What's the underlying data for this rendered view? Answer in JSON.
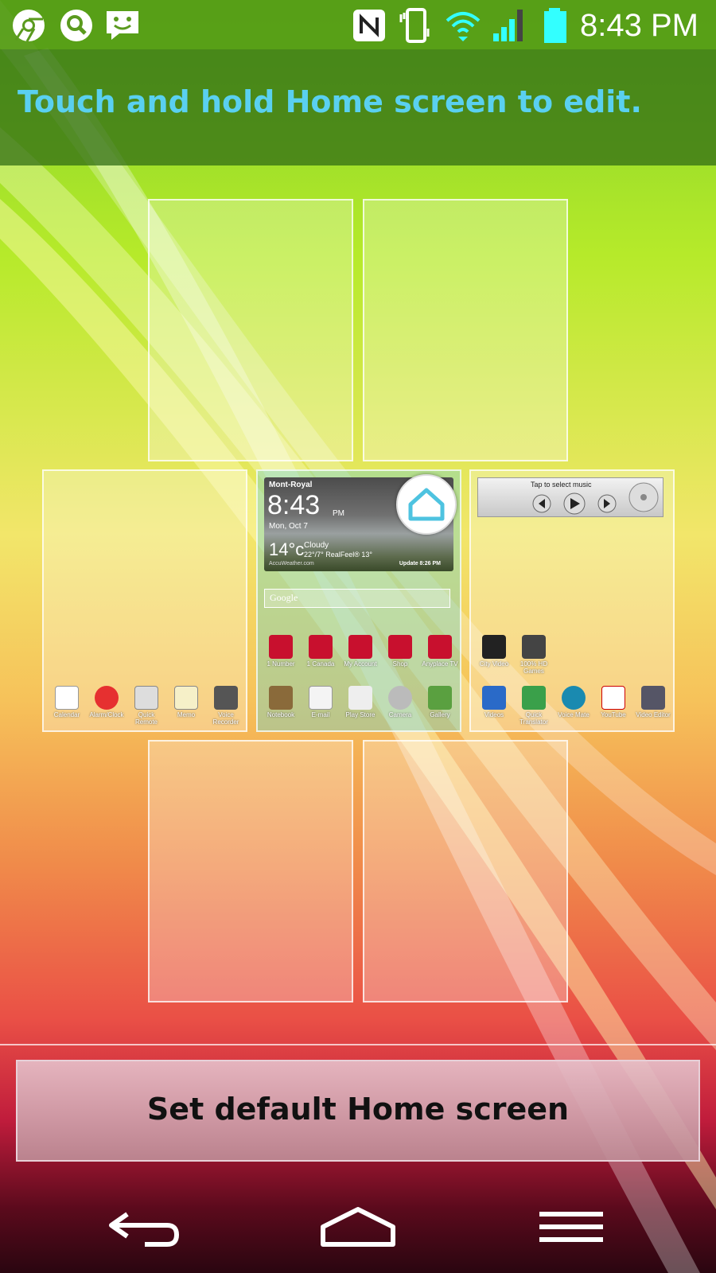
{
  "status_bar": {
    "time": "8:43 PM",
    "icons": [
      "chrome-icon",
      "search-icon",
      "messaging-icon",
      "nfc-icon",
      "vibrate-icon",
      "wifi-icon",
      "signal-icon",
      "battery-icon"
    ]
  },
  "hint": {
    "text": "Touch and hold Home screen to edit."
  },
  "home_widget": {
    "location": "Mont-Royal",
    "time": "8:43",
    "ampm": "PM",
    "date": "Mon, Oct 7",
    "temperature": "14°c",
    "condition": "Cloudy",
    "range": "22°/7°  RealFeel® 13°",
    "source": "AccuWeather.com",
    "update": "Update 8:26 PM",
    "search_placeholder": "Google"
  },
  "music_widget": {
    "text": "Tap to select music"
  },
  "left_panel_apps": [
    {
      "label": "Calendar",
      "icon": "calendar-icon"
    },
    {
      "label": "Alarm/Clock",
      "icon": "alarm-icon"
    },
    {
      "label": "Quick Remote",
      "icon": "remote-icon"
    },
    {
      "label": "Memo",
      "icon": "memo-icon"
    },
    {
      "label": "Voice Recorder",
      "icon": "recorder-icon"
    }
  ],
  "home_panel_apps_row1": [
    {
      "label": "1 Number",
      "icon": "number-icon"
    },
    {
      "label": "1 Canada",
      "icon": "canada-icon"
    },
    {
      "label": "My Account",
      "icon": "account-icon"
    },
    {
      "label": "Shop",
      "icon": "shop-icon"
    },
    {
      "label": "Anyplace TV",
      "icon": "tv-icon"
    }
  ],
  "home_panel_apps_row2": [
    {
      "label": "Notebook",
      "icon": "notebook-icon"
    },
    {
      "label": "E-mail",
      "icon": "email-icon"
    },
    {
      "label": "Play Store",
      "icon": "play-store-icon"
    },
    {
      "label": "Camera",
      "icon": "camera-icon"
    },
    {
      "label": "Gallery",
      "icon": "gallery-icon"
    }
  ],
  "right_panel_apps_row1": [
    {
      "label": "City Video",
      "icon": "city-video-icon"
    },
    {
      "label": "100% HD Games",
      "icon": "games-icon"
    }
  ],
  "right_panel_apps_row2": [
    {
      "label": "Videos",
      "icon": "videos-icon"
    },
    {
      "label": "Quick Translator",
      "icon": "translator-icon"
    },
    {
      "label": "Voice Mate",
      "icon": "voice-mate-icon"
    },
    {
      "label": "YouTube",
      "icon": "youtube-icon"
    },
    {
      "label": "Video Editor",
      "icon": "video-editor-icon"
    }
  ],
  "button": {
    "label": "Set default Home screen"
  },
  "navbar": {
    "icons": [
      "back-icon",
      "home-icon",
      "menu-icon"
    ]
  },
  "colors": {
    "hint_text": "#5ad0f0",
    "status_bar": "#5a9a1e"
  }
}
